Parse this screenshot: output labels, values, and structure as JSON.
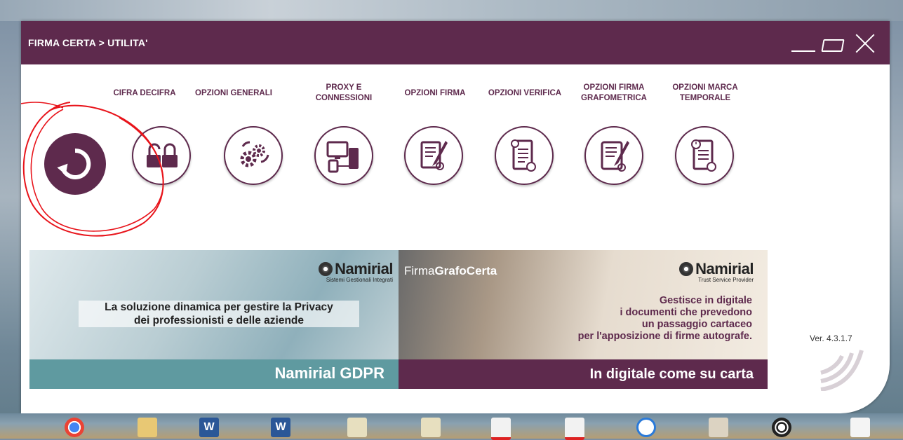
{
  "window": {
    "title": "FIRMA CERTA > UTILITA'",
    "controls": [
      "minimize",
      "maximize",
      "close"
    ]
  },
  "toolbar": {
    "items": [
      {
        "label": "",
        "icon": "refresh-icon"
      },
      {
        "label": "CIFRA DECIFRA",
        "icon": "padlocks-icon"
      },
      {
        "label": "OPZIONI GENERALI",
        "icon": "gears-icon"
      },
      {
        "label": "PROXY E CONNESSIONI",
        "icon": "network-devices-icon"
      },
      {
        "label": "OPZIONI FIRMA",
        "icon": "sign-document-icon"
      },
      {
        "label": "OPZIONI VERIFICA",
        "icon": "verify-document-icon"
      },
      {
        "label": "OPZIONI FIRMA GRAFOMETRICA",
        "icon": "tablet-sign-icon"
      },
      {
        "label": "OPZIONI MARCA TEMPORALE",
        "icon": "timestamp-document-icon"
      }
    ]
  },
  "banners": {
    "left": {
      "brand": "Namirial",
      "brand_sub": "Sistemi Gestionali Integrati",
      "tagline_1": "La soluzione dinamica per gestire la Privacy",
      "tagline_2": "dei professionisti e delle aziende",
      "footer": "Namirial GDPR"
    },
    "right": {
      "product_prefix": "Firma",
      "product_bold": "GrafoCerta",
      "brand": "Namirial",
      "brand_sub": "Trust Service Provider",
      "desc_1": "Gestisce in digitale",
      "desc_2": "i documenti che prevedono",
      "desc_3": "un passaggio cartaceo",
      "desc_4": "per l'apposizione di firme autografe.",
      "footer": "In digitale come su carta"
    }
  },
  "version": "Ver. 4.3.1.7",
  "colors": {
    "accent": "#5e2a4d",
    "teal": "#5f9aa0",
    "annotation": "#e8141b"
  },
  "taskbar": {
    "icons": [
      "chrome-icon",
      "folder-icon",
      "word-icon",
      "word-icon",
      "document-icon",
      "document-icon",
      "pdf-icon",
      "pdf-icon",
      "app-icon",
      "document-icon",
      "circle-app-icon",
      "document-icon"
    ]
  }
}
